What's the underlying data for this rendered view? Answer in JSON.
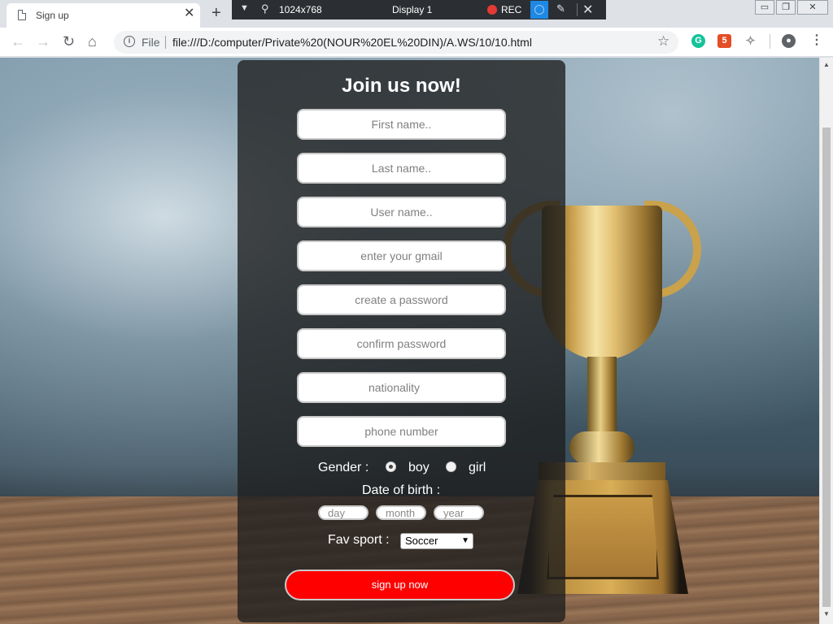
{
  "browser": {
    "tab_title": "Sign up",
    "tab_close": "✕",
    "new_tab": "+",
    "omnibox_scheme": "File",
    "url": "file:///D:/computer/Private%20(NOUR%20EL%20DIN)/A.WS/10/10.html",
    "icons": {
      "back": "←",
      "forward": "→",
      "reload": "↻",
      "home": "⌂",
      "info": "i",
      "star": "☆",
      "menu": "⋮"
    }
  },
  "recorder": {
    "resolution": "1024x768",
    "display": "Display 1",
    "rec_label": "REC"
  },
  "form": {
    "heading": "Join us now!",
    "placeholders": {
      "first_name": "First name..",
      "last_name": "Last name..",
      "user_name": "User name..",
      "gmail": "enter your gmail",
      "password": "create a password",
      "confirm": "confirm password",
      "nationality": "nationality",
      "phone": "phone number",
      "day": "day",
      "month": "month",
      "year": "year"
    },
    "gender_label": "Gender :",
    "gender_options": [
      "boy",
      "girl"
    ],
    "gender_selected": "boy",
    "dob_label": "Date of birth :",
    "sport_label": "Fav sport :",
    "sport_value": "Soccer",
    "submit_label": "sign up now"
  },
  "colors": {
    "submit": "#ff0000",
    "panel": "rgba(30,30,30,0.78)",
    "rec_dot": "#e53935"
  }
}
